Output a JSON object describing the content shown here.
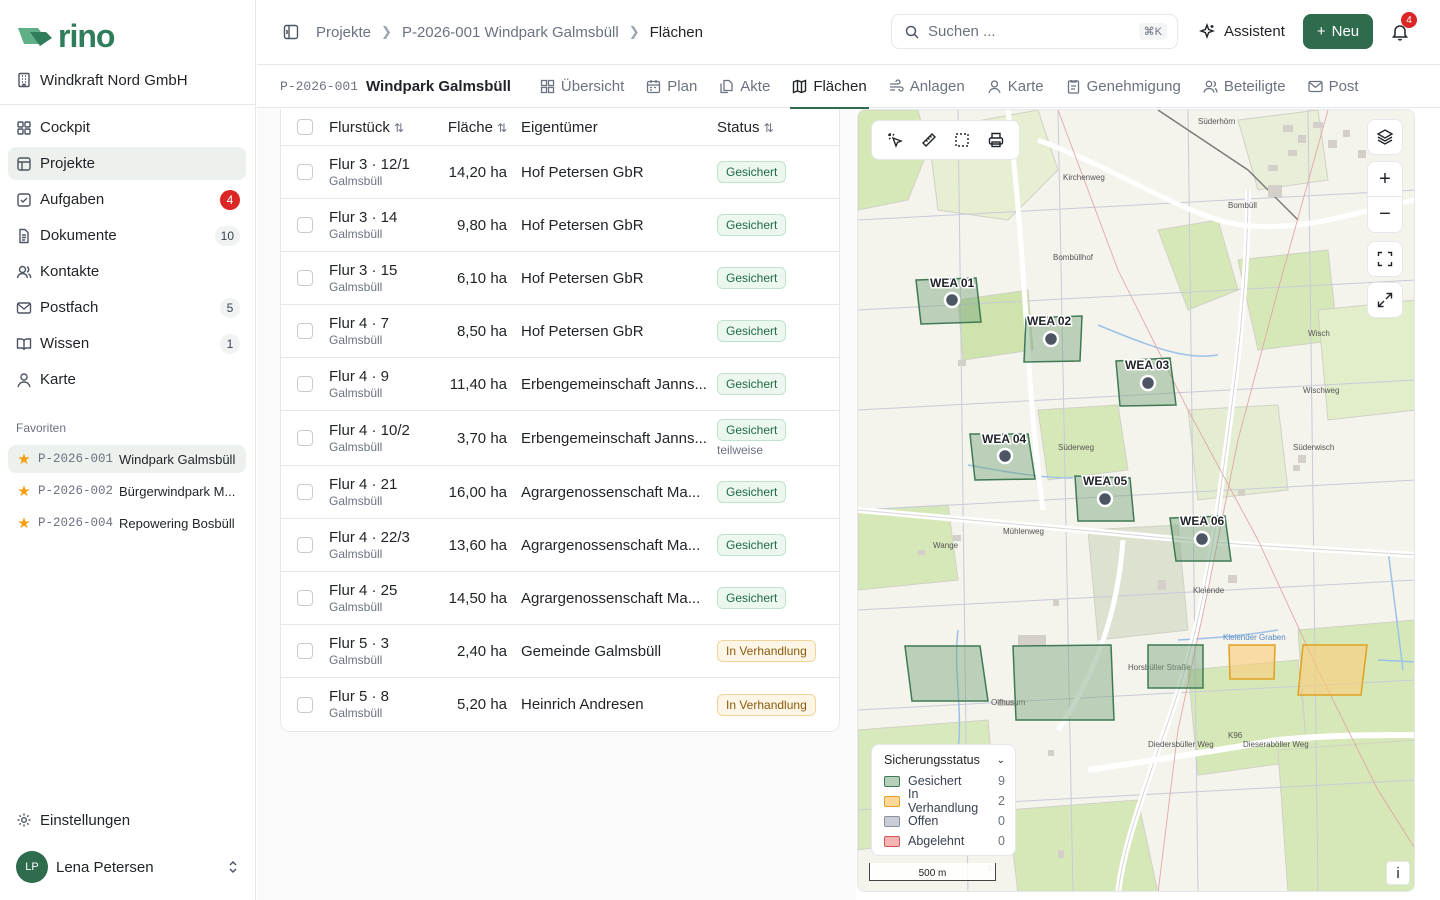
{
  "app": {
    "logo_text": "rino",
    "org_name": "Windkraft Nord GmbH"
  },
  "sidebar": {
    "items": [
      {
        "label": "Cockpit",
        "icon": "grid-icon",
        "badge": null
      },
      {
        "label": "Projekte",
        "icon": "folder-icon",
        "badge": null
      },
      {
        "label": "Aufgaben",
        "icon": "checkbox-icon",
        "badge": "4"
      },
      {
        "label": "Dokumente",
        "icon": "document-icon",
        "badge": "10"
      },
      {
        "label": "Kontakte",
        "icon": "user-icon",
        "badge": null
      },
      {
        "label": "Postfach",
        "icon": "mail-icon",
        "badge": "5"
      },
      {
        "label": "Wissen",
        "icon": "book-icon",
        "badge": "1"
      },
      {
        "label": "Karte",
        "icon": "map-pin-icon",
        "badge": null
      }
    ],
    "favorites_heading": "Favoriten",
    "favorites": [
      {
        "code": "P-2026-001",
        "name": "Windpark Galmsbüll"
      },
      {
        "code": "P-2026-002",
        "name": "Bürgerwindpark M..."
      },
      {
        "code": "P-2026-004",
        "name": "Repowering Bosbüll"
      }
    ],
    "settings_label": "Einstellungen",
    "user": {
      "initials": "LP",
      "name": "Lena Petersen"
    }
  },
  "header": {
    "breadcrumbs": [
      "Projekte",
      "P-2026-001 Windpark Galmsbüll",
      "Flächen"
    ],
    "search": {
      "placeholder": "Suchen ...",
      "shortcut": "⌘K"
    },
    "assistant_label": "Assistent",
    "new_label": "Neu",
    "notifications_count": "4"
  },
  "project_tabs": {
    "code": "P-2026-001",
    "name": "Windpark Galmsbüll",
    "tabs": [
      {
        "label": "Übersicht",
        "icon": "layout-icon"
      },
      {
        "label": "Plan",
        "icon": "calendar-icon"
      },
      {
        "label": "Akte",
        "icon": "files-icon"
      },
      {
        "label": "Flächen",
        "icon": "map-icon",
        "active": true
      },
      {
        "label": "Anlagen",
        "icon": "wind-icon"
      },
      {
        "label": "Karte",
        "icon": "map-pin-icon"
      },
      {
        "label": "Genehmigung",
        "icon": "clipboard-icon"
      },
      {
        "label": "Beteiligte",
        "icon": "users-icon"
      },
      {
        "label": "Post",
        "icon": "mail-icon"
      }
    ]
  },
  "table": {
    "columns": {
      "parcel": "Flurstück",
      "area": "Fläche",
      "owner": "Eigentümer",
      "status": "Status"
    },
    "rows": [
      {
        "parcel": "Flur 3 · 12/1",
        "place": "Galmsbüll",
        "area": "14,20 ha",
        "owner": "Hof Petersen GbR",
        "status": "Gesichert",
        "kind": "ok",
        "note": ""
      },
      {
        "parcel": "Flur 3 · 14",
        "place": "Galmsbüll",
        "area": "9,80 ha",
        "owner": "Hof Petersen GbR",
        "status": "Gesichert",
        "kind": "ok",
        "note": ""
      },
      {
        "parcel": "Flur 3 · 15",
        "place": "Galmsbüll",
        "area": "6,10 ha",
        "owner": "Hof Petersen GbR",
        "status": "Gesichert",
        "kind": "ok",
        "note": ""
      },
      {
        "parcel": "Flur 4 · 7",
        "place": "Galmsbüll",
        "area": "8,50 ha",
        "owner": "Hof Petersen GbR",
        "status": "Gesichert",
        "kind": "ok",
        "note": ""
      },
      {
        "parcel": "Flur 4 · 9",
        "place": "Galmsbüll",
        "area": "11,40 ha",
        "owner": "Erbengemeinschaft Janns...",
        "status": "Gesichert",
        "kind": "ok",
        "note": ""
      },
      {
        "parcel": "Flur 4 · 10/2",
        "place": "Galmsbüll",
        "area": "3,70 ha",
        "owner": "Erbengemeinschaft Janns...",
        "status": "Gesichert",
        "kind": "ok",
        "note": "teilweise"
      },
      {
        "parcel": "Flur 4 · 21",
        "place": "Galmsbüll",
        "area": "16,00 ha",
        "owner": "Agrargenossenschaft Ma...",
        "status": "Gesichert",
        "kind": "ok",
        "note": ""
      },
      {
        "parcel": "Flur 4 · 22/3",
        "place": "Galmsbüll",
        "area": "13,60 ha",
        "owner": "Agrargenossenschaft Ma...",
        "status": "Gesichert",
        "kind": "ok",
        "note": ""
      },
      {
        "parcel": "Flur 4 · 25",
        "place": "Galmsbüll",
        "area": "14,50 ha",
        "owner": "Agrargenossenschaft Ma...",
        "status": "Gesichert",
        "kind": "ok",
        "note": ""
      },
      {
        "parcel": "Flur 5 · 3",
        "place": "Galmsbüll",
        "area": "2,40 ha",
        "owner": "Gemeinde Galmsbüll",
        "status": "In Verhandlung",
        "kind": "neg",
        "note": ""
      },
      {
        "parcel": "Flur 5 · 8",
        "place": "Galmsbüll",
        "area": "5,20 ha",
        "owner": "Heinrich Andresen",
        "status": "In Verhandlung",
        "kind": "neg",
        "note": ""
      }
    ]
  },
  "map": {
    "turbines": [
      "WEA 01",
      "WEA 02",
      "WEA 03",
      "WEA 04",
      "WEA 05",
      "WEA 06"
    ],
    "place_labels": [
      "Süderhörn",
      "Bombüll",
      "Bombüllhof",
      "Wisch",
      "Süderweg",
      "Süderwisch",
      "Mühlenweg",
      "Wange",
      "Kleiende",
      "Kleiender Graben",
      "Olfhusum",
      "Diedersbüller Weg",
      "Dieseraböller Weg",
      "K96",
      "Wischweg",
      "Kirchenweg",
      "Horsbüller Straße"
    ],
    "legend": {
      "title": "Sicherungsstatus",
      "items": [
        {
          "label": "Gesichert",
          "count": "9",
          "fill": "#b5cfb9",
          "stroke": "#3f7a55"
        },
        {
          "label": "In Verhandlung",
          "count": "2",
          "fill": "#fbd79a",
          "stroke": "#e0a21f"
        },
        {
          "label": "Offen",
          "count": "0",
          "fill": "#c9ced6",
          "stroke": "#8a929c"
        },
        {
          "label": "Abgelehnt",
          "count": "0",
          "fill": "#f4b5b5",
          "stroke": "#d45555"
        }
      ]
    },
    "scale_label": "500 m",
    "info_label": "i"
  },
  "colors": {
    "brand": "#2f6b4d",
    "danger": "#dc2626"
  }
}
